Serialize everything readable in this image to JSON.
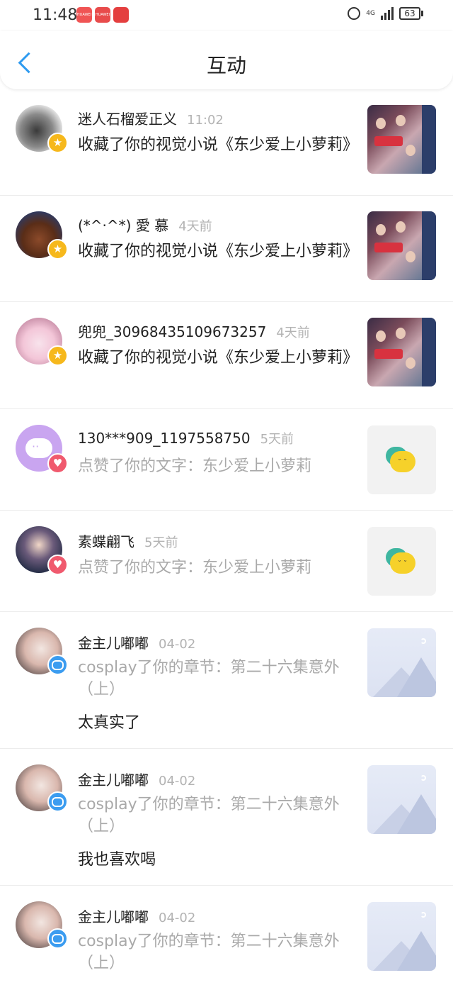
{
  "status_bar": {
    "time": "11:48",
    "network": "4G",
    "battery": "63",
    "app_icons": [
      "huawei-app",
      "huawei-app",
      "store-app"
    ]
  },
  "header": {
    "title": "互动"
  },
  "items": [
    {
      "name": "迷人石榴爱正义",
      "time": "11:02",
      "action": "收藏了你的视觉小说《东少爱上小萝莉》",
      "action_style": "dark",
      "badge": "star-icon",
      "thumb": "book-cover",
      "comment": ""
    },
    {
      "name": "(*^·^*) 愛 慕",
      "time": "4天前",
      "action": "收藏了你的视觉小说《东少爱上小萝莉》",
      "action_style": "dark",
      "badge": "star-icon",
      "thumb": "book-cover",
      "comment": ""
    },
    {
      "name": "兜兜_30968435109673257",
      "time": "4天前",
      "action": "收藏了你的视觉小说《东少爱上小萝莉》",
      "action_style": "dark",
      "badge": "star-icon",
      "thumb": "book-cover",
      "comment": ""
    },
    {
      "name": "130***909_1197558750",
      "time": "5天前",
      "action": "点赞了你的文字：东少爱上小萝莉",
      "action_style": "gray",
      "badge": "heart-icon",
      "thumb": "chat-placeholder",
      "comment": ""
    },
    {
      "name": "素蝶翩飞",
      "time": "5天前",
      "action": "点赞了你的文字：东少爱上小萝莉",
      "action_style": "gray",
      "badge": "heart-icon",
      "thumb": "chat-placeholder",
      "comment": ""
    },
    {
      "name": "金主儿嘟嘟",
      "time": "04-02",
      "action": "cosplay了你的章节：第二十六集意外（上）",
      "action_style": "gray",
      "badge": "comment-icon",
      "thumb": "landscape-placeholder",
      "comment": "太真实了"
    },
    {
      "name": "金主儿嘟嘟",
      "time": "04-02",
      "action": "cosplay了你的章节：第二十六集意外（上）",
      "action_style": "gray",
      "badge": "comment-icon",
      "thumb": "landscape-placeholder",
      "comment": "我也喜欢喝"
    },
    {
      "name": "金主儿嘟嘟",
      "time": "04-02",
      "action": "cosplay了你的章节：第二十六集意外（上）",
      "action_style": "gray",
      "badge": "comment-icon",
      "thumb": "landscape-placeholder",
      "comment": ""
    }
  ]
}
